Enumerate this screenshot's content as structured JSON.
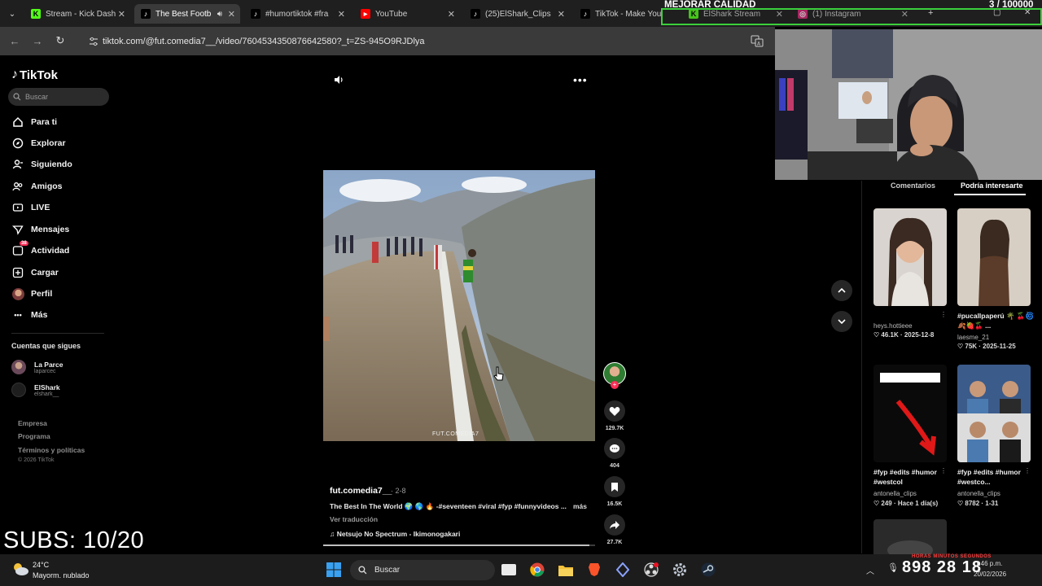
{
  "browser": {
    "tabs": [
      {
        "label": "Stream - Kick Dash",
        "favicon": "kick-icon",
        "color": "#53fc18"
      },
      {
        "label": "The Best Footb",
        "favicon": "tiktok-icon",
        "color": "#000000",
        "active": true
      },
      {
        "label": "#humortiktok #fra",
        "favicon": "tiktok-icon",
        "color": "#000000"
      },
      {
        "label": "YouTube",
        "favicon": "youtube-icon",
        "color": "#ff0000"
      },
      {
        "label": "(25)ElShark_Clips",
        "favicon": "tiktok-icon",
        "color": "#000000"
      },
      {
        "label": "TikTok - Make You",
        "favicon": "tiktok-icon",
        "color": "#000000"
      },
      {
        "label": "ElShark Stream",
        "favicon": "kick-icon",
        "color": "#53fc18"
      },
      {
        "label": "(1) Instagram",
        "favicon": "instagram-icon",
        "color": "#d62976"
      }
    ],
    "url": "tiktok.com/@fut.comedia7__/video/7604534350876642580?_t=ZS-945O9RJDlya"
  },
  "overlay": {
    "quality_label": "MEJORAR CALIDAD",
    "counter": "3 / 100000",
    "subs": "SUBS: 10/20",
    "timer": "898 28 18",
    "red_labels": "HORAS   MINUTOS   SEGUNDOS",
    "accent_green": "#3ccf3c"
  },
  "tiktok": {
    "logo": "TikTok",
    "search_placeholder": "Buscar",
    "nav": [
      {
        "label": "Para ti",
        "icon": "home-icon"
      },
      {
        "label": "Explorar",
        "icon": "compass-icon"
      },
      {
        "label": "Siguiendo",
        "icon": "following-icon"
      },
      {
        "label": "Amigos",
        "icon": "friends-icon"
      },
      {
        "label": "LIVE",
        "icon": "live-icon"
      },
      {
        "label": "Mensajes",
        "icon": "messages-icon"
      },
      {
        "label": "Actividad",
        "icon": "activity-icon",
        "badge": "38"
      },
      {
        "label": "Cargar",
        "icon": "upload-icon"
      },
      {
        "label": "Perfil",
        "icon": "profile-avatar"
      },
      {
        "label": "Más",
        "icon": "more-dots-icon"
      }
    ],
    "following_title": "Cuentas que sigues",
    "following": [
      {
        "name": "La Parce",
        "handle": "laparcec"
      },
      {
        "name": "ElShark",
        "handle": "elshark__"
      }
    ],
    "footer": [
      "Empresa",
      "Programa",
      "Términos y políticas"
    ],
    "copyright": "© 2026 TikTok",
    "video": {
      "watermark": "FUT.COMEDIA7",
      "author": "fut.comedia7__",
      "date": "· 2-8",
      "description": "The Best In The World 🌍 🌎 🔥 -#seventeen #viral #fyp #funnyvideos ...",
      "more": "más",
      "translate": "Ver traducción",
      "music": "♫  Netsujo No Spectrum - Ikimonogakari",
      "progress": 0.98,
      "likes": "129.7K",
      "comments": "404",
      "saves": "16.5K",
      "shares": "27.7K"
    },
    "panel": {
      "tabs": [
        "Comentarios",
        "Podría interesarte"
      ],
      "items": [
        {
          "caption": "",
          "user": "heys.hottieee",
          "stats": "♡ 46.1K · 2025-12-8"
        },
        {
          "caption": "#pucallpaperú 🌴 🍒🌀🍂🍓🍒 ...",
          "user": "laesme_21",
          "stats": "♡ 75K · 2025-11-25"
        },
        {
          "caption": "#fyp #edits #humor #westcol",
          "user": "antonella_clips",
          "stats": "♡ 249 · Hace 1 día(s)"
        },
        {
          "caption": "#fyp #edits #humor #westco...",
          "user": "antonella_clips",
          "stats": "♡ 8782 · 1-31"
        }
      ]
    }
  },
  "taskbar": {
    "temperature": "24°C",
    "weather": "Mayorm. nublado",
    "search": "Buscar",
    "time": "1:46 p.m.",
    "date": "20/02/2026"
  }
}
